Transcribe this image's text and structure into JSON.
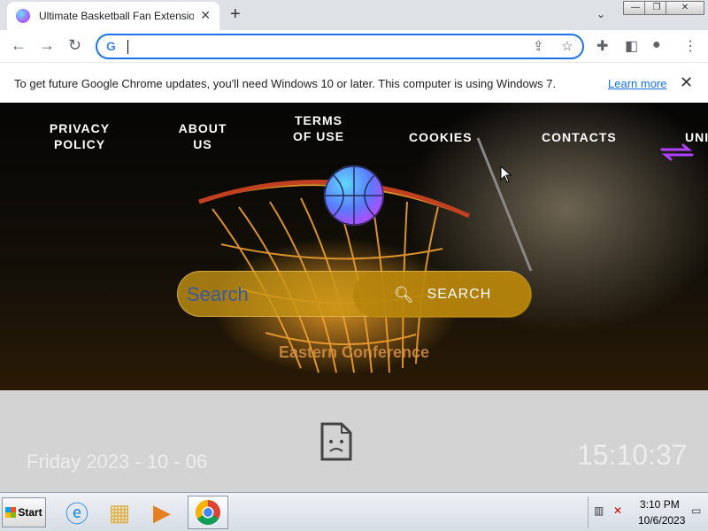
{
  "browser": {
    "tab_title": "Ultimate Basketball Fan Extension",
    "tab_close": "✕",
    "new_tab": "+",
    "tab_dropdown": "⌄",
    "window_minimize": "—",
    "window_restore": "❐",
    "window_close": "✕",
    "omnibox_value": "",
    "omnibox_icon": "G"
  },
  "infobar": {
    "message": "To get future Google Chrome updates, you'll need Windows 10 or later. This computer is using Windows 7.",
    "link": "Learn more",
    "close": "✕"
  },
  "nav": {
    "privacy": "PRIVACY POLICY",
    "about": "ABOUT US",
    "terms": "TERMS OF USE",
    "cookies": "COOKIES",
    "contacts": "CONTACTS",
    "partial": "UNI"
  },
  "search": {
    "placeholder": "Search",
    "button": "SEARCH"
  },
  "conference": "Eastern Conference",
  "date_text": "Friday 2023 - 10 - 06",
  "time_text": "15:10:37",
  "taskbar": {
    "start": "Start",
    "tray_time": "3:10 PM",
    "tray_date": "10/6/2023"
  },
  "colors": {
    "accent": "#1a73e8",
    "search_bar": "#c8961a",
    "conference": "#dc9646"
  }
}
